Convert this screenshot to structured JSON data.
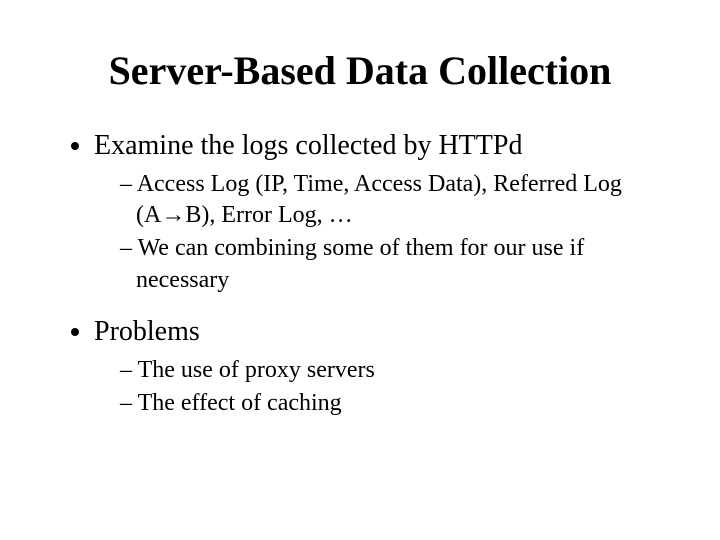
{
  "title": "Server-Based Data Collection",
  "bullets": [
    {
      "text": "Examine the logs collected by HTTPd",
      "sub": [
        "Access Log (IP, Time, Access Data), Referred Log (A→B), Error Log, …",
        "We can combining some of them for our use if necessary"
      ]
    },
    {
      "text": "Problems",
      "sub": [
        "The use of proxy servers",
        "The effect of caching"
      ]
    }
  ]
}
